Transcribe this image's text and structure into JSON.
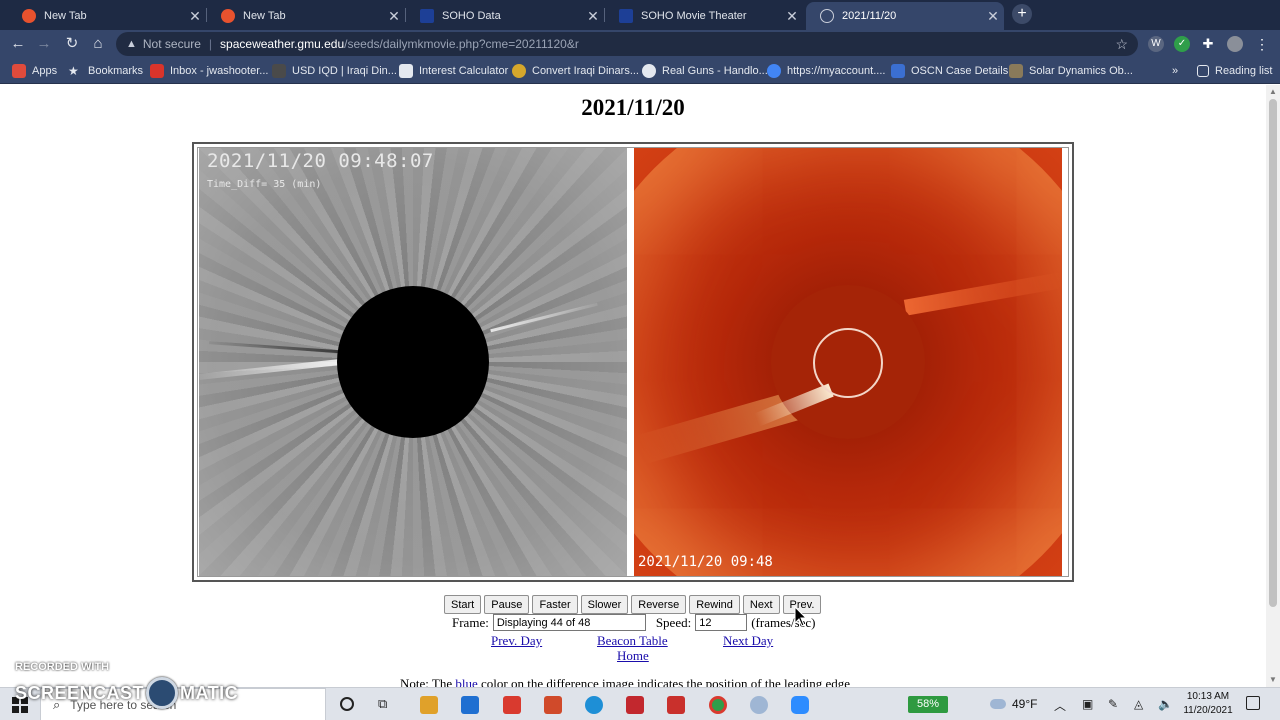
{
  "browser": {
    "tabs": [
      {
        "title": "New Tab",
        "favicon_color": "#e8522e",
        "active": false
      },
      {
        "title": "New Tab",
        "favicon_color": "#e8522e",
        "active": false
      },
      {
        "title": "SOHO Data",
        "favicon_color": "#1d3f96",
        "active": false
      },
      {
        "title": "SOHO Movie Theater",
        "favicon_color": "#1d3f96",
        "active": false
      },
      {
        "title": "2021/11/20",
        "favicon_color": "#c9ceda",
        "active": true
      }
    ],
    "address": {
      "security_label": "Not secure",
      "host": "spaceweather.gmu.edu",
      "path": "/seeds/dailymkmovie.php?cme=20211120&r"
    },
    "bookmarks": [
      {
        "label": "Apps",
        "color": "#e04b3c"
      },
      {
        "label": "Bookmarks",
        "color": "#e4e8ef"
      },
      {
        "label": "Inbox - jwashooter...",
        "color": "#d9342b"
      },
      {
        "label": "USD IQD | Iraqi Din...",
        "color": "#4a4a4a"
      },
      {
        "label": "Interest Calculator",
        "color": "#e4e8ef"
      },
      {
        "label": "Convert Iraqi Dinars...",
        "color": "#d6a72b"
      },
      {
        "label": "Real Guns - Handlo...",
        "color": "#e4e8ef"
      },
      {
        "label": "https://myaccount....",
        "color": "#4285f4"
      },
      {
        "label": "OSCN Case Details",
        "color": "#3b6fd1"
      },
      {
        "label": "Solar Dynamics Ob...",
        "color": "#8a7a5a"
      }
    ],
    "reading_list": "Reading list",
    "overflow": "»"
  },
  "page": {
    "title": "2021/11/20",
    "c2_timestamp": "2021/11/20 09:48:07",
    "c2_timediff": "Time_Diff= 35 (min)",
    "c3_timestamp": "2021/11/20 09:48",
    "controls": {
      "start": "Start",
      "pause": "Pause",
      "faster": "Faster",
      "slower": "Slower",
      "reverse": "Reverse",
      "rewind": "Rewind",
      "next": "Next",
      "prev": "Prev."
    },
    "frame_label": "Frame:",
    "frame_value": "Displaying 44 of 48",
    "speed_label": "Speed:",
    "speed_value": "12",
    "speed_unit": "(frames/sec)",
    "links": {
      "prev_day": "Prev. Day",
      "beacon_table": "Beacon Table",
      "home": "Home",
      "next_day": "Next Day"
    },
    "note_start": "Note: The",
    "note_blue": "blue",
    "note_end": "color on the difference image indicates the position of the leading edge"
  },
  "watermark": {
    "recorded_with": "RECORDED WITH",
    "brand_left": "SCREENCAST",
    "brand_right": "MATIC"
  },
  "taskbar": {
    "search_placeholder": "Type here to search",
    "battery": "58%",
    "weather": "49°F",
    "time": "10:13 AM",
    "date": "11/20/2021",
    "app_colors": [
      "#e0a12a",
      "#1f6fd1",
      "#d93a2f",
      "#d04a2a",
      "#1e8fd6",
      "#c2282e",
      "#c9302c",
      "#2f9e4a",
      "#9fb6d4",
      "#2d8cff"
    ]
  }
}
